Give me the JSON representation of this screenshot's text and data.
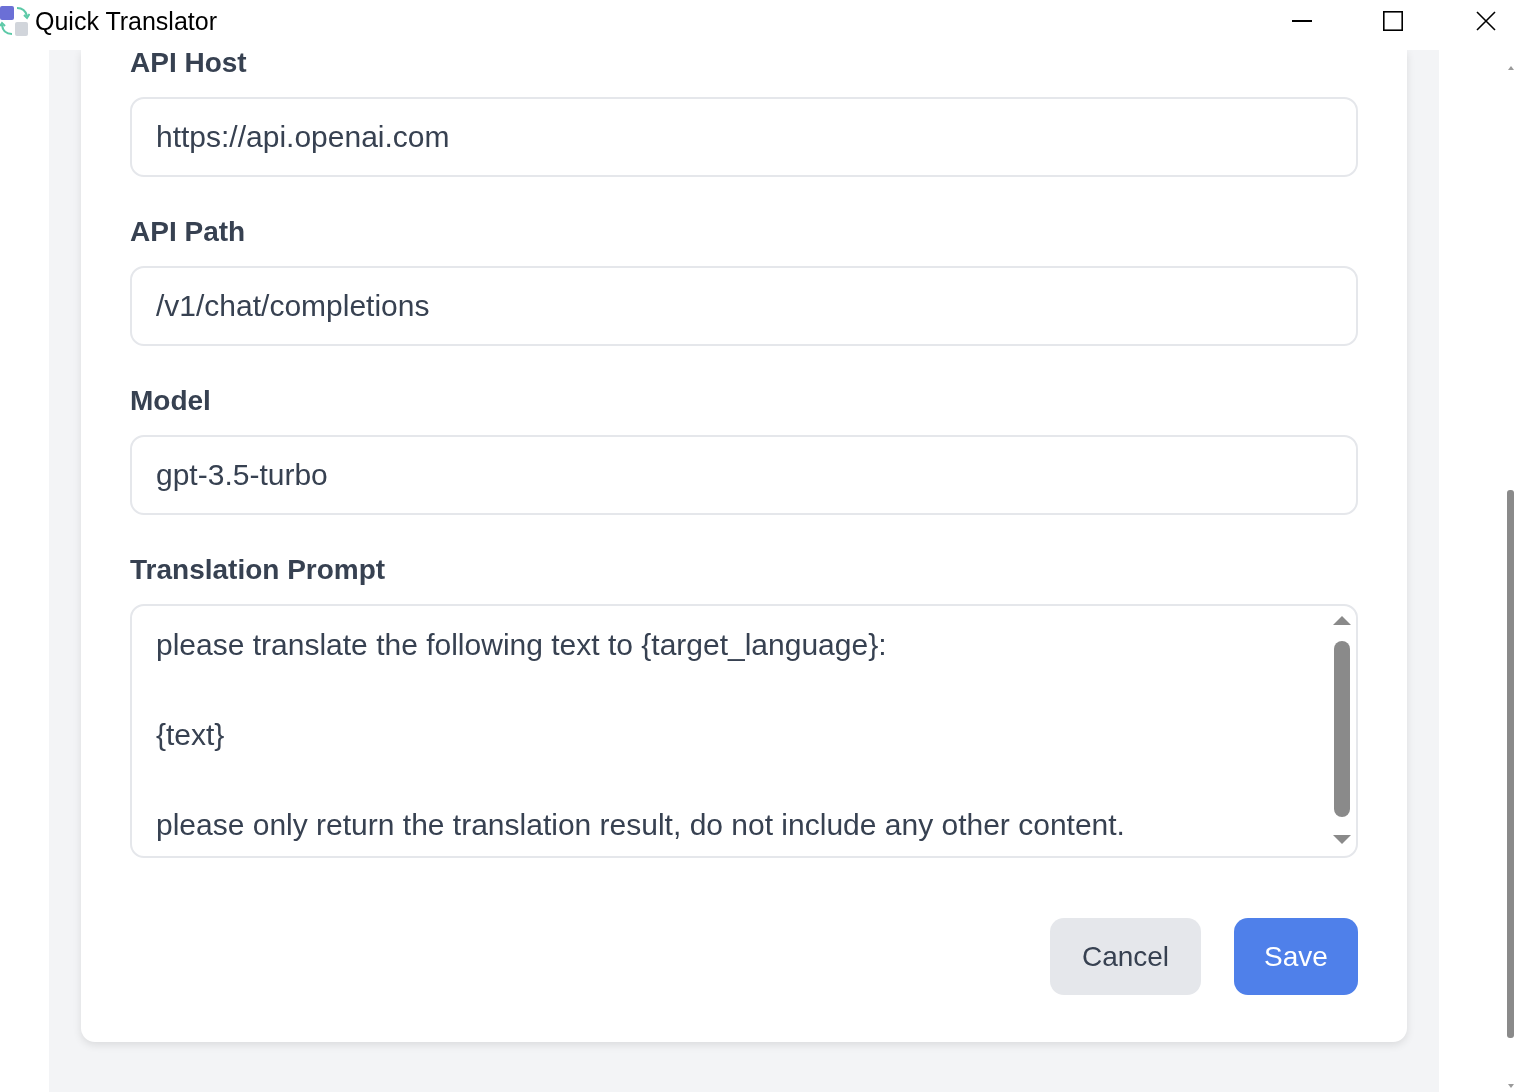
{
  "window": {
    "title": "Quick Translator"
  },
  "form": {
    "fields": [
      {
        "kind": "input",
        "label": "API Host",
        "value": "https://api.openai.com"
      },
      {
        "kind": "input",
        "label": "API Path",
        "value": "/v1/chat/completions"
      },
      {
        "kind": "input",
        "label": "Model",
        "value": "gpt-3.5-turbo"
      },
      {
        "kind": "textarea",
        "label": "Translation Prompt",
        "value": "please translate the following text to {target_language}:\n\n{text}\n\nplease only return the translation result, do not include any other content."
      }
    ],
    "buttons": [
      {
        "kind": "secondary",
        "label": "Cancel"
      },
      {
        "kind": "primary",
        "label": "Save"
      }
    ]
  }
}
